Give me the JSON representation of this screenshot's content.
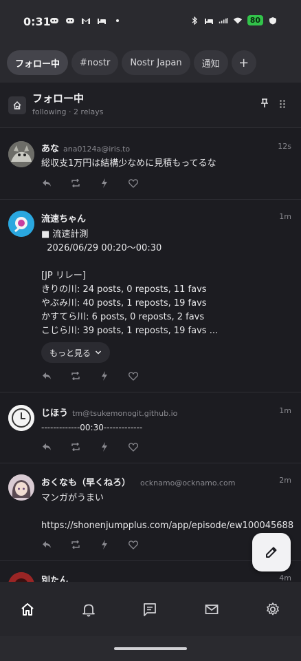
{
  "status_bar": {
    "time": "0:31",
    "battery": "80",
    "left_icons": [
      "discord-icon",
      "discord-icon",
      "gmail-icon",
      "bed-icon",
      "dot-icon"
    ],
    "right_icons": [
      "bluetooth-icon",
      "bed-icon",
      "signal-icon",
      "wifi-icon",
      "battery-icon"
    ]
  },
  "tabs": [
    {
      "label": "フォロー中",
      "active": true
    },
    {
      "label": "#nostr",
      "active": false
    },
    {
      "label": "Nostr Japan",
      "active": false
    },
    {
      "label": "通知",
      "active": false
    }
  ],
  "tab_add_label": "+",
  "column": {
    "title": "フォロー中",
    "subtitle": "following · 2 relays"
  },
  "posts": [
    {
      "name": "あな",
      "address": "ana0124a@iris.to",
      "time": "12s",
      "body": "総収支1万円は結構少なめに見積もってるな"
    },
    {
      "name": "流速ちゃん",
      "address": "",
      "time": "1m",
      "body": "■ 流速計測\n  2026/06/29 00:20〜00:30\n\n[JP リレー]\nきりの川: 24 posts, 0 reposts, 11 favs\nやぶみ川: 40 posts, 1 reposts, 19 favs\nかすてら川: 6 posts, 0 reposts, 2 favs\nこじら川: 39 posts, 1 reposts, 19 favs ...",
      "more_label": "もっと見る"
    },
    {
      "name": "じほう",
      "address": "tm@tsukemonogit.github.io",
      "time": "1m",
      "body": "-------------00:30-------------"
    },
    {
      "name": "おくなも（早くねろ）",
      "address": "ocknamo@ocknamo.com",
      "time": "2m",
      "body": "マンガがうまい\n\nhttps://shonenjumpplus.com/app/episode/ew100045688"
    },
    {
      "name": "別たん",
      "address": "",
      "time": "4m",
      "body": ""
    }
  ],
  "bottom_nav": [
    "home-icon",
    "bell-icon",
    "message-icon",
    "mail-icon",
    "settings-icon"
  ],
  "colors": {
    "background": "#1c1c21",
    "surface": "#2a2a2f",
    "battery_green": "#32c34a",
    "text_muted": "#8a8a90"
  }
}
